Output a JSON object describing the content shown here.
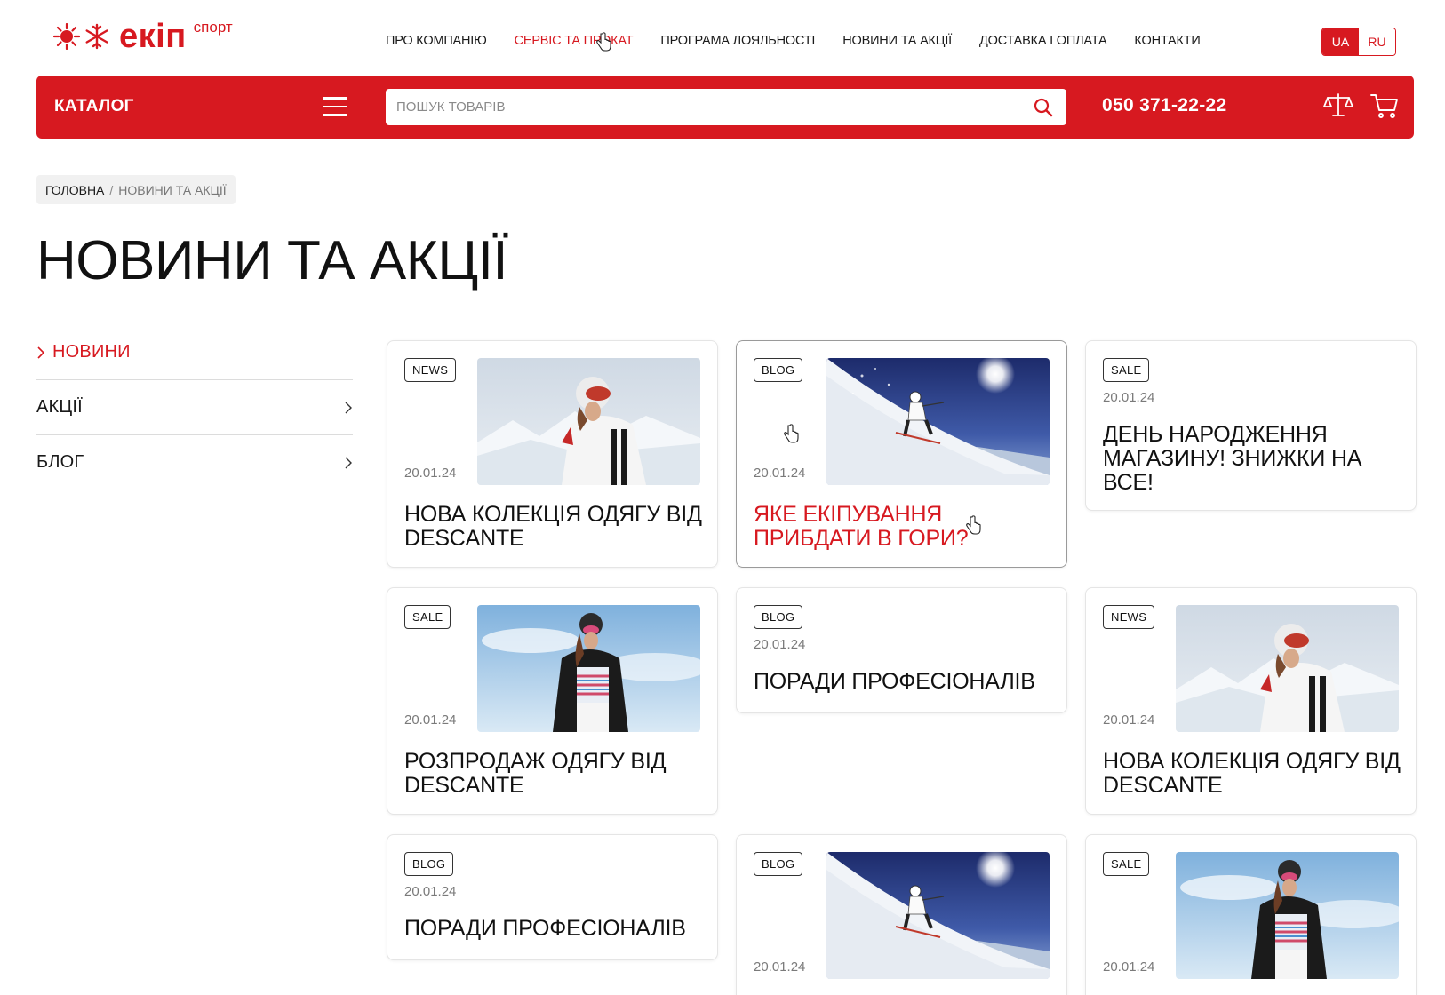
{
  "brand": {
    "name": "екіп",
    "tagline": "спорт",
    "color": "#d71920"
  },
  "top_nav": [
    {
      "label": "ПРО КОМПАНІЮ",
      "active": false
    },
    {
      "label": "СЕРВІС ТА ПРОКАТ",
      "active": true
    },
    {
      "label": "ПРОГРАМА ЛОЯЛЬНОСТІ",
      "active": false
    },
    {
      "label": "НОВИНИ ТА АКЦІЇ",
      "active": false
    },
    {
      "label": "ДОСТАВКА І ОПЛАТА",
      "active": false
    },
    {
      "label": "КОНТАКТИ",
      "active": false
    }
  ],
  "languages": {
    "ua": "UA",
    "ru": "RU",
    "selected": "UA"
  },
  "header": {
    "catalog_label": "КАТАЛОГ",
    "search_placeholder": "ПОШУК ТОВАРІВ",
    "phone": "050 371-22-22",
    "icons": [
      "menu-icon",
      "search-icon",
      "compare-scale-icon",
      "cart-icon"
    ]
  },
  "breadcrumb": {
    "home": "ГОЛОВНА",
    "separator": "/",
    "current": "НОВИНИ ТА АКЦІЇ"
  },
  "page_title": "НОВИНИ ТА АКЦІЇ",
  "sidebar": [
    {
      "label": "НОВИНИ",
      "active": true
    },
    {
      "label": "АКЦІЇ",
      "active": false
    },
    {
      "label": "БЛОГ",
      "active": false
    }
  ],
  "cards": [
    {
      "badge": "NEWS",
      "date": "20.01.24",
      "title": "НОВА КОЛЕКЦІЯ ОДЯГУ ВІД DESCANTE",
      "image": "skier-woman-white-jacket"
    },
    {
      "badge": "BLOG",
      "date": "20.01.24",
      "title": "ЯКЕ ЕКІПУВАННЯ ПРИБДАТИ В ГОРИ?",
      "image": "skier-downhill-slope",
      "highlighted": true
    },
    {
      "badge": "SALE",
      "date": "20.01.24",
      "title": "ДЕНЬ НАРОДЖЕННЯ МАГАЗИНУ! ЗНИЖКИ НА ВСЕ!",
      "image": ""
    },
    {
      "badge": "SALE",
      "date": "20.01.24",
      "title": "РОЗПРОДАЖ ОДЯГУ ВІД DESCANTE",
      "image": "skier-woman-black-jacket"
    },
    {
      "badge": "BLOG",
      "date": "20.01.24",
      "title": "ПОРАДИ ПРОФЕСІОНАЛІВ",
      "image": ""
    },
    {
      "badge": "NEWS",
      "date": "20.01.24",
      "title": "НОВА КОЛЕКЦІЯ ОДЯГУ ВІД DESCANTE",
      "image": "skier-woman-white-jacket"
    },
    {
      "badge": "BLOG",
      "date": "20.01.24",
      "title": "ПОРАДИ ПРОФЕСІОНАЛІВ",
      "image": ""
    },
    {
      "badge": "BLOG",
      "date": "20.01.24",
      "title": "",
      "image": "skier-downhill-slope"
    },
    {
      "badge": "SALE",
      "date": "20.01.24",
      "title": "",
      "image": "skier-woman-black-jacket"
    }
  ],
  "colors": {
    "accent": "#d71920",
    "text": "#111111",
    "muted": "#7a7a7a",
    "breadcrumb_bg": "#f1f1f1"
  }
}
